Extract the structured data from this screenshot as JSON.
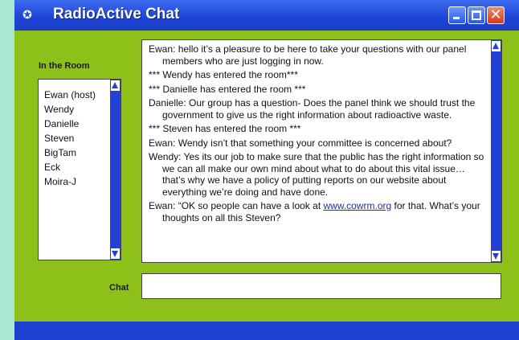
{
  "window": {
    "title": "RadioActive Chat",
    "title_icon": "app-icon",
    "colors": {
      "titlebar": "#1f45d8",
      "client": "#8ec01a",
      "scroll": "#2240d8",
      "close": "#d8391c"
    }
  },
  "room": {
    "label": "In the Room",
    "users": [
      "Ewan (host)",
      "Wendy",
      "Danielle",
      "Steven",
      "BigTam",
      "Eck",
      "Moira-J"
    ]
  },
  "messages": [
    {
      "speaker": "Ewan:",
      "text": "hello it’s a pleasure to be here to take your questions with our panel members who are just logging in now."
    },
    {
      "speaker": "",
      "text": "*** Wendy has entered the room***"
    },
    {
      "speaker": "",
      "text": "*** Danielle has entered the room ***"
    },
    {
      "speaker": "Danielle:",
      "text": "Our group has a question-  Does the panel think we should trust the government to give us the right information about radioactive waste."
    },
    {
      "speaker": "",
      "text": "*** Steven has entered the room ***"
    },
    {
      "speaker": "Ewan:",
      "text": "Wendy isn’t that something your committee is concerned about?"
    },
    {
      "speaker": "Wendy:",
      "text": "Yes its our job to make sure that the public has the right information so we can all make our own mind about what to do about this vital issue…that’s why we have a policy of putting reports on our website about everything we’re doing and have done."
    },
    {
      "speaker": "Ewan:",
      "text_before": "“OK so people can have a look at",
      "link": "www.cowrm.org",
      "text_after": "for that. What’s your thoughts on all this Steven?"
    }
  ],
  "chat": {
    "label": "Chat",
    "value": "",
    "placeholder": ""
  }
}
